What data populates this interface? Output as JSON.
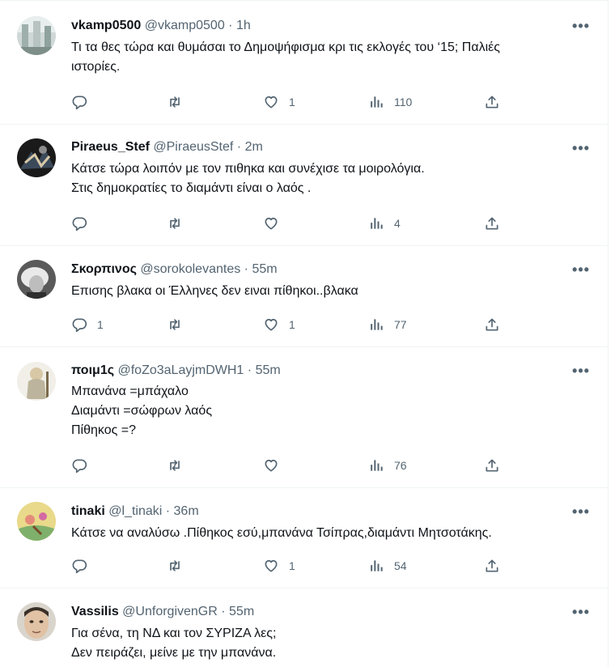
{
  "tweets": [
    {
      "name": "vkamp0500",
      "handle": "@vkamp0500",
      "time": "1h",
      "lines": [
        "Τι τα θες τώρα και θυμάσαι το Δημοψήφισμα κρι τις εκλογές του ‘15; Παλιές",
        "ιστορίες."
      ],
      "replies": "",
      "retweets": "",
      "likes": "1",
      "views": "110"
    },
    {
      "name": "Piraeus_Stef",
      "handle": "@PiraeusStef",
      "time": "2m",
      "lines": [
        "Κάτσε τώρα λοιπόν με τον πιθηκα και συνέχισε τα μοιρολόγια.",
        "Στις δημοκρατίες το διαμάντι είναι ο λαός ."
      ],
      "replies": "",
      "retweets": "",
      "likes": "",
      "views": "4"
    },
    {
      "name": "Σκορπινος",
      "handle": "@sorokolevantes",
      "time": "55m",
      "lines": [
        "Επισης βλακα οι Έλληνες δεν ειναι πίθηκοι..βλακα"
      ],
      "replies": "1",
      "retweets": "",
      "likes": "1",
      "views": "77"
    },
    {
      "name": "ποιμ1ς",
      "handle": "@foZo3aLayjmDWH1",
      "time": "55m",
      "lines": [
        "Μπανάνα =μπάχαλο",
        "Διαμάντι =σώφρων λαός",
        "Πίθηκος =?"
      ],
      "replies": "",
      "retweets": "",
      "likes": "",
      "views": "76"
    },
    {
      "name": "tinaki",
      "handle": "@l_tinaki",
      "time": "36m",
      "lines": [
        "Κάτσε να αναλύσω .Πίθηκος εσύ,μπανάνα Τσίπρας,διαμάντι Μητσοτάκης."
      ],
      "replies": "",
      "retweets": "",
      "likes": "1",
      "views": "54"
    },
    {
      "name": "Vassilis",
      "handle": "@UnforgivenGR",
      "time": "55m",
      "lines": [
        "Για σένα, τη ΝΔ και τον ΣΥΡΙΖΑ λες;",
        "Δεν πειράζει, μείνε με την μπανάνα."
      ],
      "replies": "",
      "retweets": "",
      "likes": "",
      "views": ""
    }
  ],
  "ui": {
    "separator": "·",
    "more_label": "•••",
    "icons": [
      "reply-icon",
      "retweet-icon",
      "like-icon",
      "views-icon",
      "share-icon",
      "more-icon"
    ],
    "colors": {
      "text": "#0f1419",
      "secondary": "#536471",
      "divider": "#eff3f4"
    }
  }
}
